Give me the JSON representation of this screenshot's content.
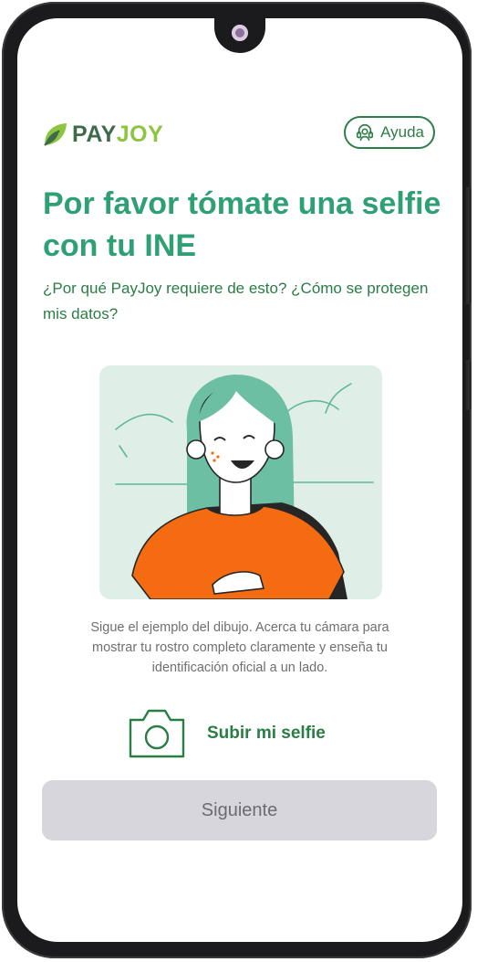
{
  "brand": {
    "name_part1": "PAY",
    "name_part2": "JOY"
  },
  "header": {
    "help_label": "Ayuda"
  },
  "content": {
    "title": "Por favor tómate una selfie con tu INE",
    "why_link": "¿Por qué PayJoy requiere de esto? ¿Cómo se protegen mis datos?",
    "instructions": "Sigue el ejemplo del dibujo. Acerca tu cámara para mostrar tu rostro completo claramente y enseña tu identificación oficial a un lado.",
    "upload_label": "Subir mi selfie",
    "next_label": "Siguiente"
  },
  "icons": {
    "logo": "leaf-logo-icon",
    "help": "help-headset-icon",
    "upload": "camera-icon"
  },
  "colors": {
    "title_green": "#2f9f74",
    "link_green": "#2a7d44",
    "logo_dark": "#3f6b4a",
    "logo_light": "#8cc63f",
    "shirt_orange": "#f46b12",
    "hair_teal": "#6dbfa3",
    "illustration_bg": "#dfefe8",
    "button_disabled_bg": "#d8d6dd",
    "button_disabled_text": "#6d6a72"
  }
}
